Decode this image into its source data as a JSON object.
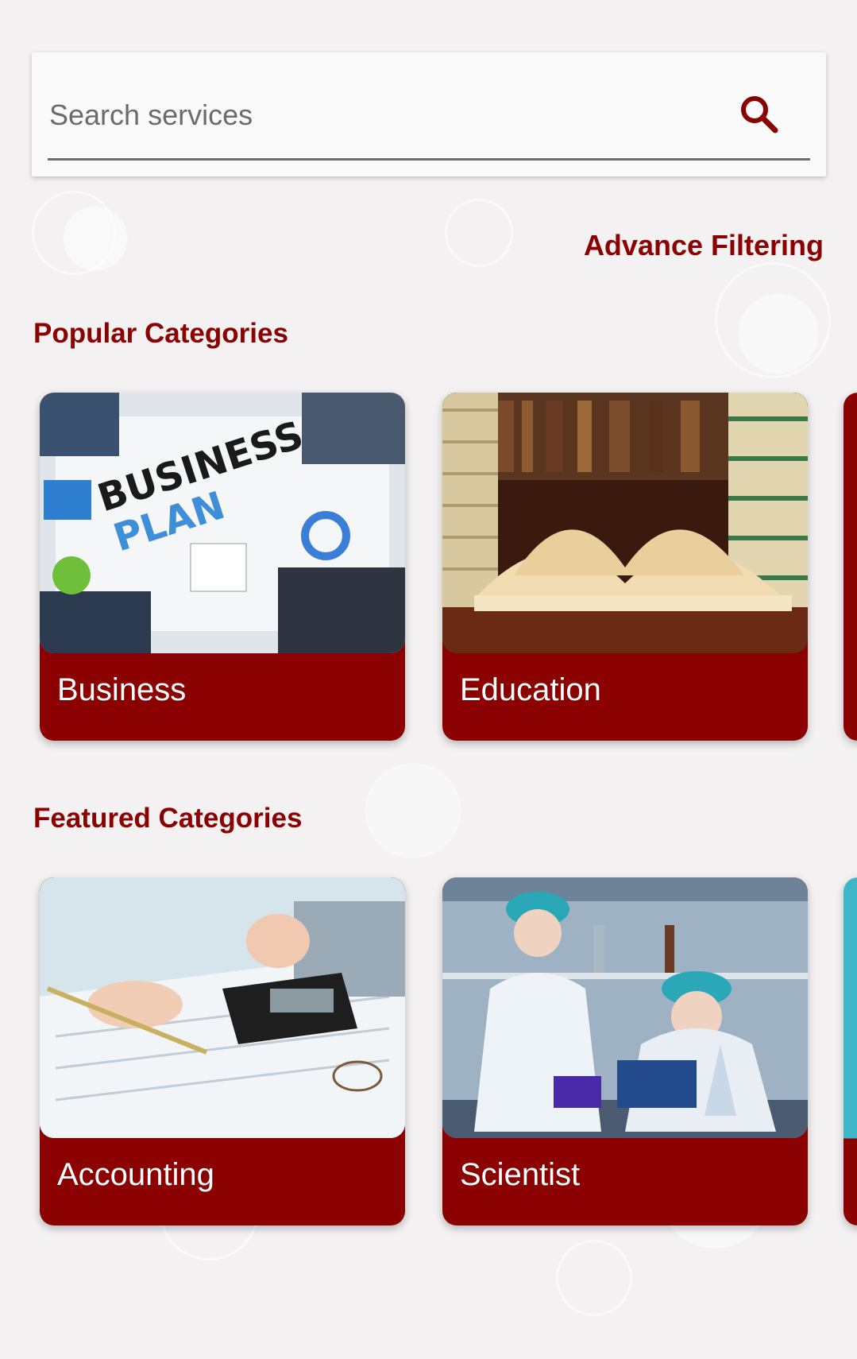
{
  "search": {
    "placeholder": "Search services"
  },
  "filter": {
    "advance_label": "Advance Filtering"
  },
  "popular": {
    "title": "Popular Categories",
    "cards": [
      {
        "label": "Business"
      },
      {
        "label": "Education"
      }
    ]
  },
  "featured": {
    "title": "Featured Categories",
    "cards": [
      {
        "label": "Accounting"
      },
      {
        "label": "Scientist"
      }
    ]
  },
  "colors": {
    "brand": "#8b0000",
    "background": "#f3f1f1",
    "card_text": "#ffffff"
  },
  "icons": {
    "search": "search-icon"
  }
}
